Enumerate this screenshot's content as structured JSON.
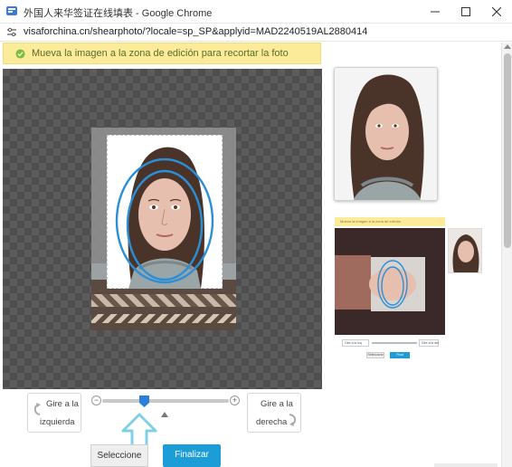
{
  "window": {
    "title": "外国人来华签证在线填表 - Google Chrome",
    "minimize_icon": "minimize-icon",
    "maximize_icon": "maximize-icon",
    "close_icon": "close-icon"
  },
  "address_bar": {
    "url": "visaforchina.cn/shearphoto/?locale=sp_SP&applyid=MAD2240519AL2880414"
  },
  "notice": {
    "icon": "check-circle-icon",
    "message": "Mueva la imagen a la zona de edición para recortar la foto",
    "color": "#fcec9a"
  },
  "editor": {
    "zoom": {
      "min_icon": "zoom-out-icon",
      "max_icon": "zoom-in-icon",
      "level": 0.35
    },
    "rotate_left": {
      "line1": "Gire a la",
      "line2": "izquierda"
    },
    "rotate_right": {
      "line1": "Gire a la",
      "line2": "derecha"
    },
    "select_button": "Seleccione de",
    "finish_button": "Finalizar",
    "finish_color": "#1c9dd8",
    "oval_color": "#2b8fd8"
  },
  "example": {
    "bar_text": "Mueva la imagen a la zona de edición",
    "rotate_left_label": "Gire a la izq",
    "rotate_right_label": "Gire a la der",
    "select_label": "Seleccione",
    "finish_label": "Final"
  }
}
